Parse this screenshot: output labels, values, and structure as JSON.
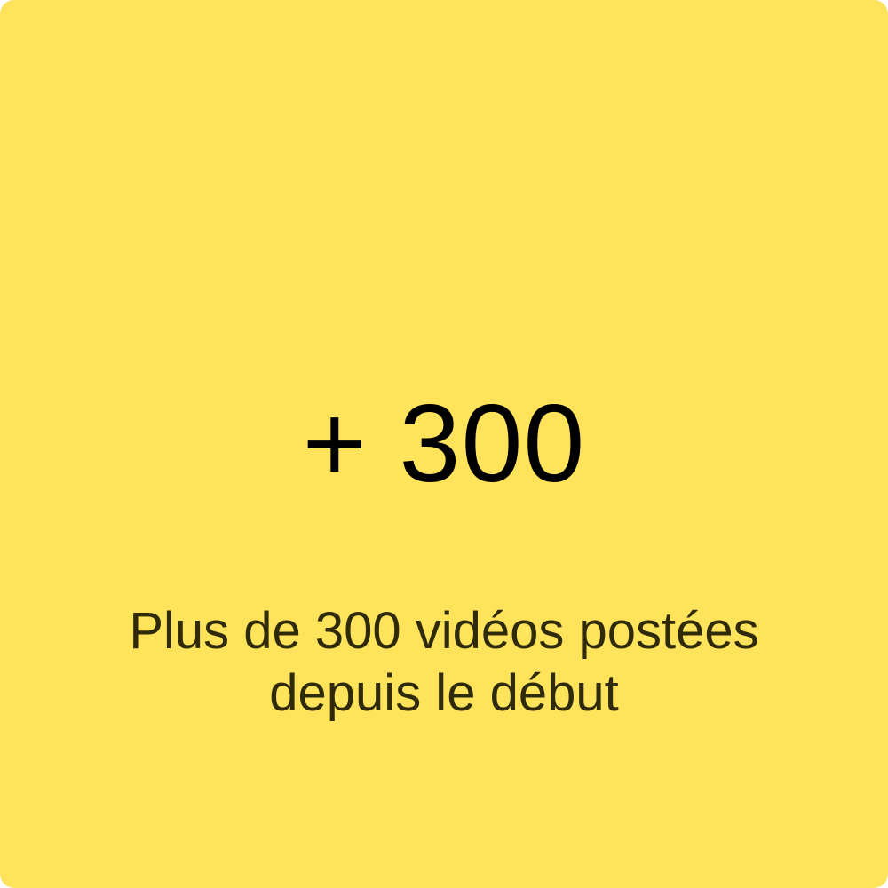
{
  "card": {
    "background_color": "#FFE35A",
    "value_color": "#000000",
    "caption_color": "#2E2A0A"
  },
  "stat": {
    "value": "+ 300",
    "caption": "Plus de 300 vidéos postées\ndepuis le début"
  }
}
